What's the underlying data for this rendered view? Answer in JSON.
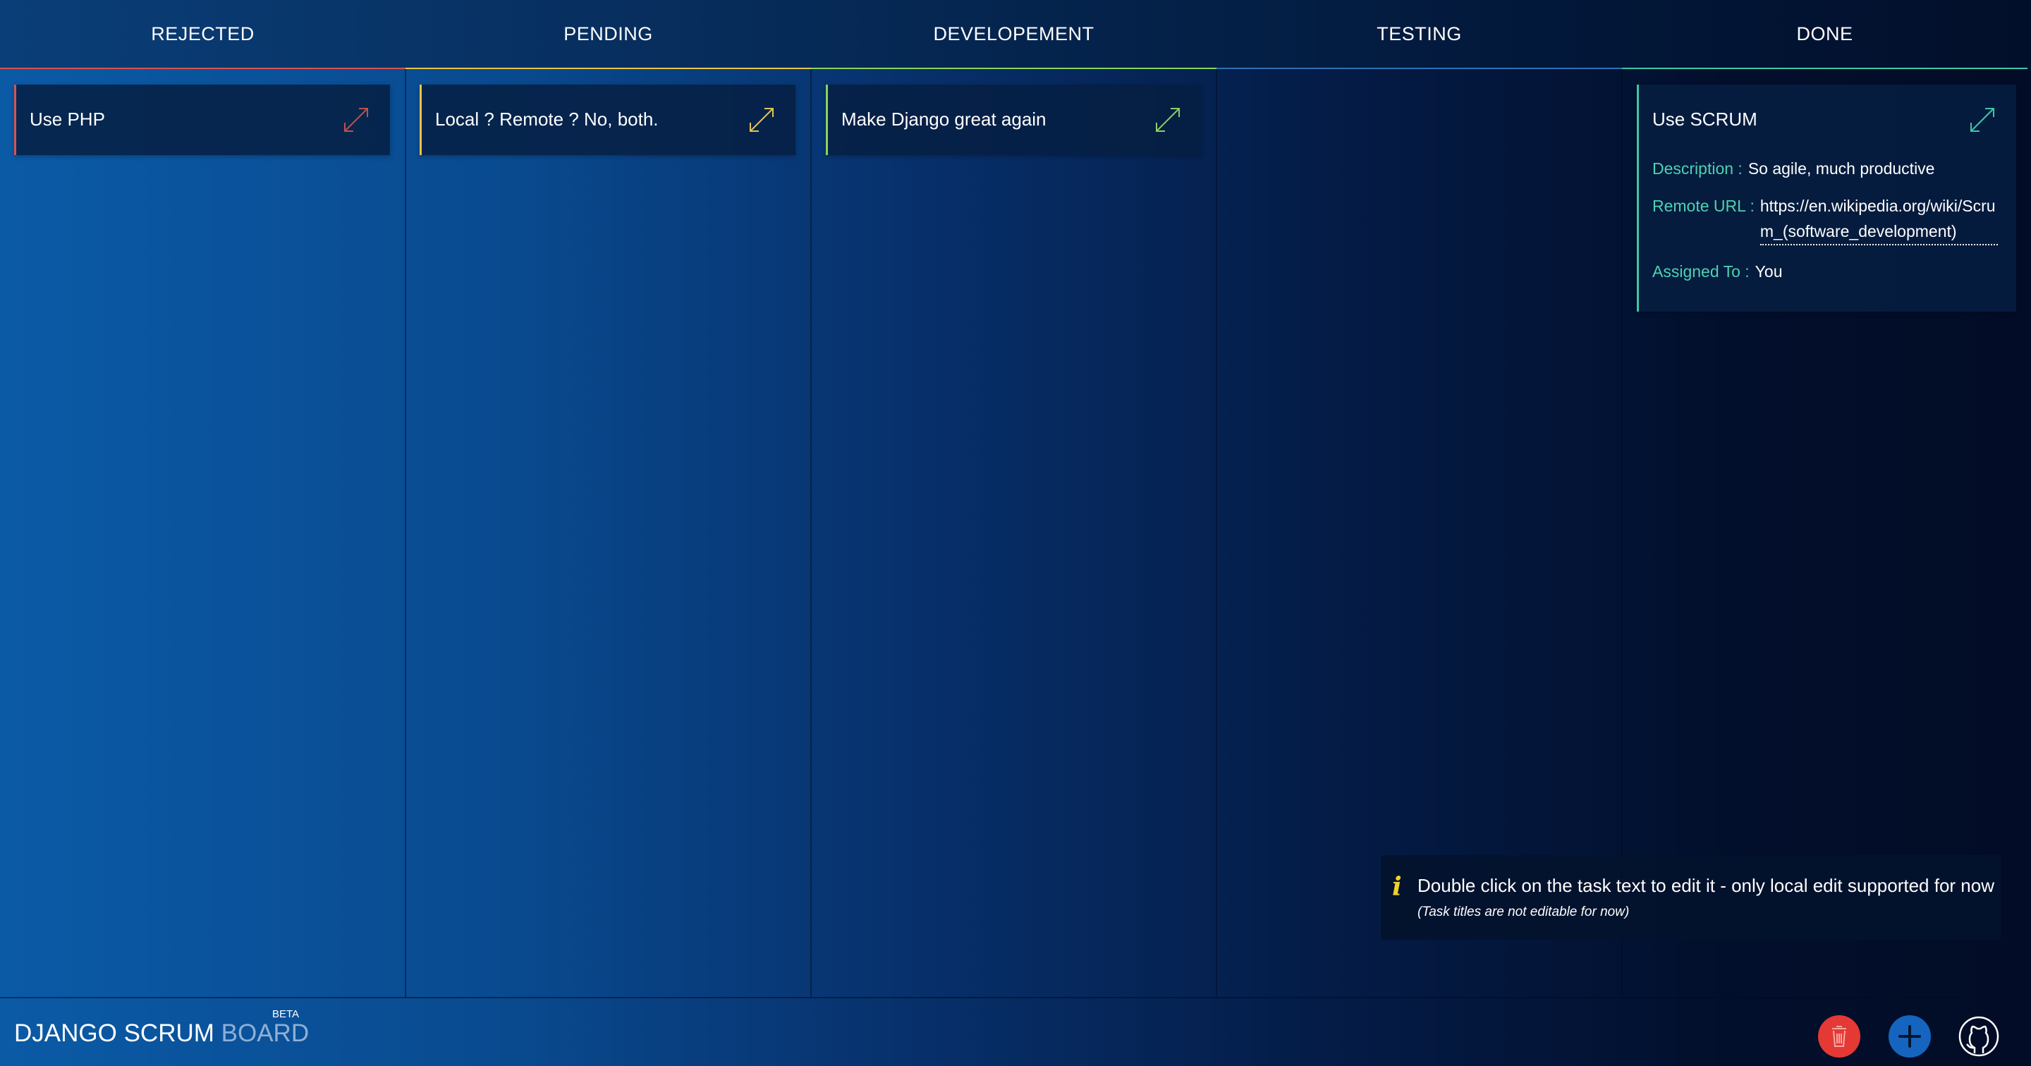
{
  "columns": [
    {
      "label": "REJECTED",
      "accent": "#d9534f"
    },
    {
      "label": "PENDING",
      "accent": "#e8c547"
    },
    {
      "label": "DEVELOPEMENT",
      "accent": "#8bd35b"
    },
    {
      "label": "TESTING",
      "accent": "#2e6fb5"
    },
    {
      "label": "DONE",
      "accent": "#3ec6a8"
    }
  ],
  "cards": [
    {
      "title": "Use PHP",
      "column": "REJECTED",
      "accent": "#d9534f",
      "icon": "expand-icon"
    },
    {
      "title": "Local ? Remote ? No, both.",
      "column": "PENDING",
      "accent": "#e8c547",
      "icon": "expand-icon"
    },
    {
      "title": "Make Django great again",
      "column": "DEVELOPEMENT",
      "accent": "#8bd35b",
      "icon": "expand-icon"
    },
    {
      "title": "Use SCRUM",
      "column": "DONE",
      "accent": "#3ec6a8",
      "icon": "expand-icon",
      "description_label": "Description :",
      "description": "So agile, much productive",
      "remote_url_label": "Remote URL :",
      "remote_url": "https://en.wikipedia.org/wiki/Scrum_(software_development)",
      "assigned_label": "Assigned To :",
      "assigned": "You"
    }
  ],
  "info": {
    "icon": "info-icon",
    "text": "Double click on the task text to edit it - only local edit supported for now",
    "subtext": "(Task titles are not editable for now)"
  },
  "footer": {
    "brand_main": "DJANGO SCRUM",
    "brand_sub": "BOARD",
    "beta": "BETA",
    "buttons": [
      {
        "name": "trash-icon",
        "color": "#e53935"
      },
      {
        "name": "plus-icon",
        "color": "#1565c0"
      },
      {
        "name": "github-icon",
        "color": "#ffffff"
      }
    ]
  }
}
